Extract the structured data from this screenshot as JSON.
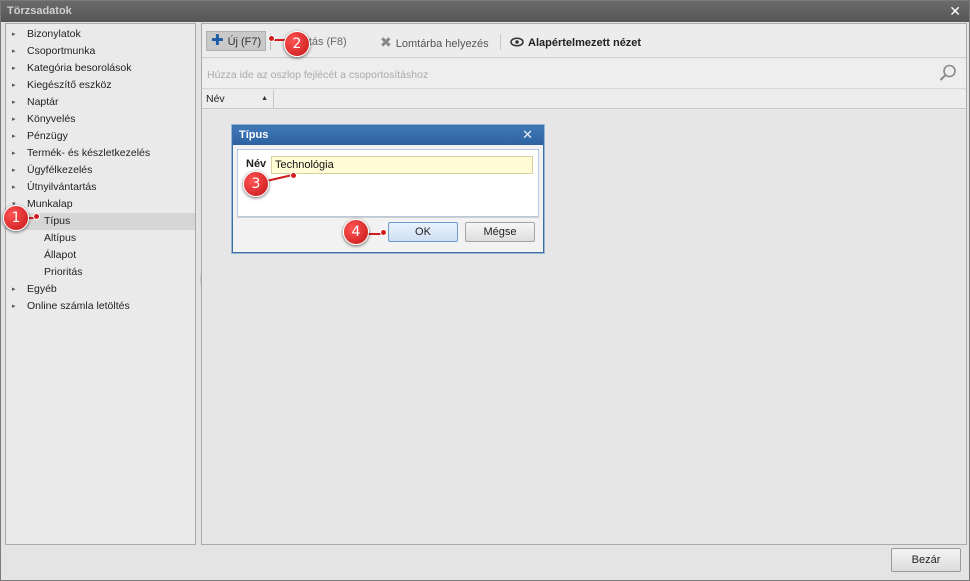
{
  "window": {
    "title": "Törzsadatok",
    "close_glyph": "✕"
  },
  "tree": [
    {
      "label": "Bizonylatok",
      "arrow": "▸"
    },
    {
      "label": "Csoportmunka",
      "arrow": "▸"
    },
    {
      "label": "Kategória besorolások",
      "arrow": "▸"
    },
    {
      "label": "Kiegészítő eszköz",
      "arrow": "▸"
    },
    {
      "label": "Naptár",
      "arrow": "▸"
    },
    {
      "label": "Könyvelés",
      "arrow": "▸"
    },
    {
      "label": "Pénzügy",
      "arrow": "▸"
    },
    {
      "label": "Termék- és készletkezelés",
      "arrow": "▸"
    },
    {
      "label": "Ügyfélkezelés",
      "arrow": "▸"
    },
    {
      "label": "Útnyilvántartás",
      "arrow": "▸"
    },
    {
      "label": "Munkalap",
      "arrow": "▾"
    },
    {
      "label": "Típus",
      "arrow": ""
    },
    {
      "label": "Altípus",
      "arrow": ""
    },
    {
      "label": "Állapot",
      "arrow": ""
    },
    {
      "label": "Prioritás",
      "arrow": ""
    },
    {
      "label": "Egyéb",
      "arrow": "▸"
    },
    {
      "label": "Online számla letöltés",
      "arrow": "▸"
    }
  ],
  "toolbar": {
    "new_label": "Új (F7)",
    "edit_label": "dosítás (F8)",
    "trash_label": "Lomtárba helyezés",
    "view_label": "Alapértelmezett nézet"
  },
  "grid": {
    "group_hint": "Húzza ide az oszlop fejlécét a csoportosításhoz",
    "column_name": "Név"
  },
  "dialog": {
    "title": "Típus",
    "field_label": "Név",
    "field_value": "Technológia",
    "ok_label": "OK",
    "cancel_label": "Mégse"
  },
  "footer": {
    "close_label": "Bezár"
  },
  "markers": [
    "1",
    "2",
    "3",
    "4"
  ],
  "colors": {
    "accent": "#2e62a0",
    "marker": "#d21d1d",
    "input_bg": "#fffbd4"
  }
}
